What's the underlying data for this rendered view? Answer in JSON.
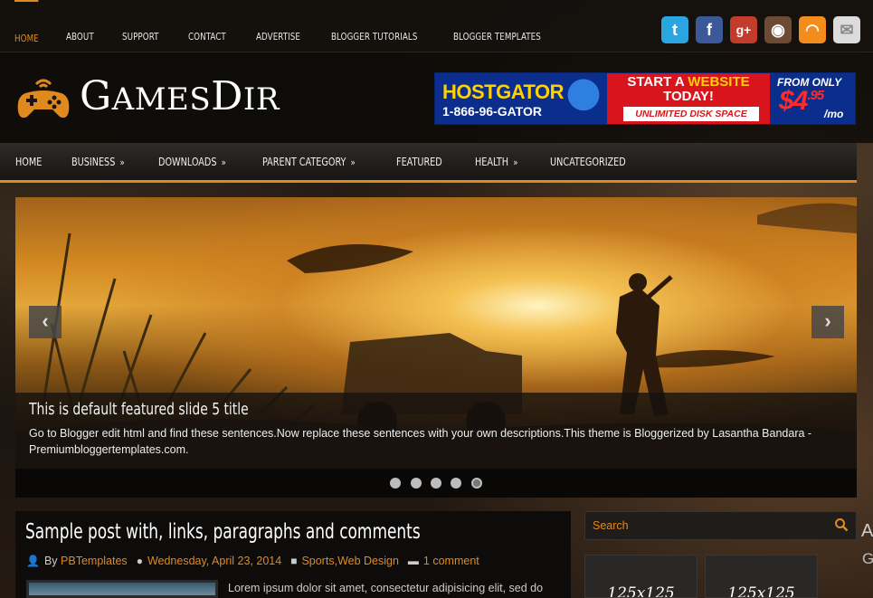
{
  "topnav": {
    "items": [
      "HOME",
      "ABOUT",
      "SUPPORT",
      "CONTACT",
      "ADVERTISE",
      "BLOGGER TUTORIALS",
      "BLOGGER TEMPLATES"
    ]
  },
  "social": {
    "icons": [
      "twitter-icon",
      "facebook-icon",
      "google-plus-icon",
      "instagram-icon",
      "rss-icon",
      "email-icon"
    ],
    "glyphs": [
      "t",
      "f",
      "g+",
      "◉",
      "◠",
      "✉"
    ]
  },
  "brand": {
    "name_first": "G",
    "name_rest_1": "AMES",
    "name_second": "D",
    "name_rest_2": "IR",
    "accent": "#e08a1e"
  },
  "banner": {
    "brand": "HOSTGATOR",
    "phone": "1-866-96-GATOR",
    "line1_a": "START A ",
    "line1_b": "WEBSITE",
    "line2": "TODAY!",
    "disk": "UNLIMITED DISK SPACE",
    "from": "FROM ONLY",
    "price_main": "$4",
    "price_cents": ".95",
    "per": "/mo"
  },
  "mainnav": {
    "items": [
      {
        "label": "HOME",
        "arrow": ""
      },
      {
        "label": "BUSINESS",
        "arrow": "»"
      },
      {
        "label": "DOWNLOADS",
        "arrow": "»"
      },
      {
        "label": "PARENT CATEGORY",
        "arrow": "»"
      },
      {
        "label": "FEATURED",
        "arrow": ""
      },
      {
        "label": "HEALTH",
        "arrow": "»"
      },
      {
        "label": "UNCATEGORIZED",
        "arrow": ""
      }
    ]
  },
  "slider": {
    "title": "This is default featured slide 5 title",
    "description": "Go to Blogger edit html and find these sentences.Now replace these sentences with your own descriptions.This theme is Bloggerized by Lasantha Bandara - Premiumbloggertemplates.com.",
    "prev": "‹",
    "next": "›",
    "slide_count": 5,
    "active_slide": 5
  },
  "post": {
    "title": "Sample post with, links, paragraphs and comments",
    "by": "By",
    "author": "PBTemplates",
    "date": "Wednesday, April 23, 2014",
    "category_1": "Sports",
    "category_sep": ", ",
    "category_2": "Web Design",
    "comments": "1 comment",
    "excerpt": "Lorem ipsum dolor sit amet, consectetur adipisicing elit, sed do"
  },
  "sidebar": {
    "search_placeholder": "Search",
    "ad_label": "125x125",
    "edge_text_1": "A",
    "edge_text_2": "G"
  }
}
